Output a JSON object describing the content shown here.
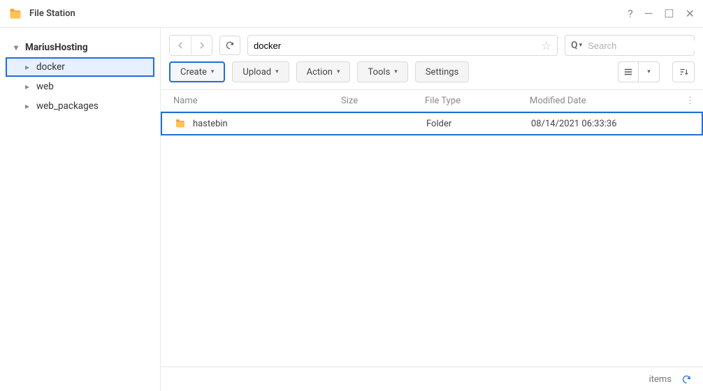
{
  "app": {
    "title": "File Station"
  },
  "sidebar": {
    "root": "MariusHosting",
    "items": [
      {
        "label": "docker",
        "selected": true
      },
      {
        "label": "web"
      },
      {
        "label": "web_packages"
      }
    ]
  },
  "toolbar": {
    "path": "docker",
    "search_placeholder": "Search",
    "buttons": {
      "create": "Create",
      "upload": "Upload",
      "action": "Action",
      "tools": "Tools",
      "settings": "Settings"
    }
  },
  "columns": {
    "name": "Name",
    "size": "Size",
    "filetype": "File Type",
    "modified": "Modified Date"
  },
  "rows": [
    {
      "name": "hastebin",
      "size": "",
      "filetype": "Folder",
      "modified": "08/14/2021 06:33:36",
      "selected": true
    }
  ],
  "footer": {
    "items_label": "items"
  }
}
